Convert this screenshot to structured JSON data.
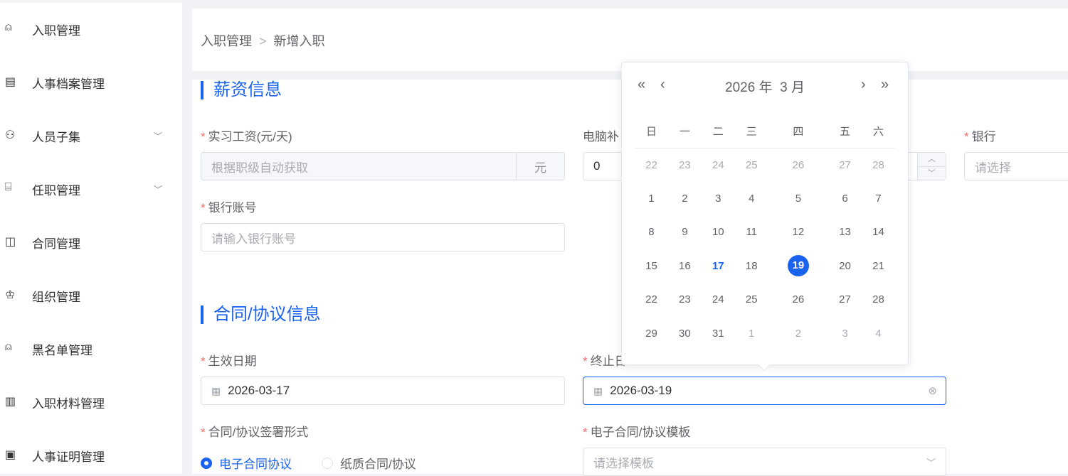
{
  "sidebar": {
    "items": [
      {
        "label": "入职管理",
        "icon": "user-add-icon"
      },
      {
        "label": "人事档案管理",
        "icon": "document-icon"
      },
      {
        "label": "人员子集",
        "icon": "users-icon",
        "chevron": true
      },
      {
        "label": "任职管理",
        "icon": "briefcase-icon",
        "chevron": true
      },
      {
        "label": "合同管理",
        "icon": "contract-icon"
      },
      {
        "label": "组织管理",
        "icon": "org-chart-icon"
      },
      {
        "label": "黑名单管理",
        "icon": "user-block-icon"
      },
      {
        "label": "入职材料管理",
        "icon": "books-icon"
      },
      {
        "label": "人事证明管理",
        "icon": "certificate-icon"
      }
    ]
  },
  "breadcrumb": {
    "parent": "入职管理",
    "current": "新增入职"
  },
  "salary": {
    "title": "薪资信息",
    "wage_label": "实习工资(元/天)",
    "wage_placeholder": "根据职级自动获取",
    "wage_unit": "元",
    "computer_label": "电脑补",
    "computer_value": "0",
    "bank_label": "银行",
    "bank_placeholder": "请选择",
    "account_label": "银行账号",
    "account_placeholder": "请输入银行账号"
  },
  "contract": {
    "title": "合同/协议信息",
    "start_label": "生效日期",
    "start_value": "2026-03-17",
    "end_label": "终止日",
    "end_value": "2026-03-19",
    "sign_label": "合同/协议签署形式",
    "sign_options": [
      "电子合同协议",
      "纸质合同/协议"
    ],
    "template_label": "电子合同/协议模板",
    "template_placeholder": "请选择模板"
  },
  "calendar": {
    "year_label": "2026 年",
    "month_label": "3 月",
    "weekdays": [
      "日",
      "一",
      "二",
      "三",
      "四",
      "五",
      "六"
    ],
    "weeks": [
      [
        "22",
        "23",
        "24",
        "25",
        "26",
        "27",
        "28"
      ],
      [
        "1",
        "2",
        "3",
        "4",
        "5",
        "6",
        "7"
      ],
      [
        "8",
        "9",
        "10",
        "11",
        "12",
        "13",
        "14"
      ],
      [
        "15",
        "16",
        "17",
        "18",
        "19",
        "20",
        "21"
      ],
      [
        "22",
        "23",
        "24",
        "25",
        "26",
        "27",
        "28"
      ],
      [
        "29",
        "30",
        "31",
        "1",
        "2",
        "3",
        "4"
      ]
    ],
    "today": "17",
    "selected": "19"
  },
  "colors": {
    "accent": "#1a62f0",
    "required": "#f56c6c"
  }
}
